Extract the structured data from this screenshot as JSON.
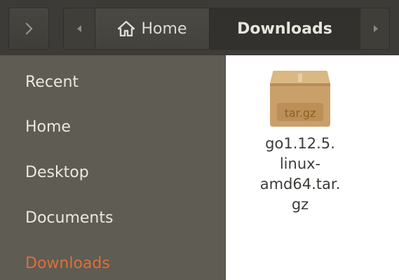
{
  "toolbar": {
    "expand_icon": "chevron-right-icon",
    "path": {
      "back_icon": "triangle-left-icon",
      "home_icon": "home-icon",
      "home_label": "Home",
      "current_label": "Downloads",
      "forward_icon": "triangle-right-icon"
    }
  },
  "sidebar": {
    "items": [
      {
        "label": "Recent",
        "active": false
      },
      {
        "label": "Home",
        "active": false
      },
      {
        "label": "Desktop",
        "active": false
      },
      {
        "label": "Documents",
        "active": false
      },
      {
        "label": "Downloads",
        "active": true
      }
    ],
    "active_color": "#e16e37"
  },
  "content": {
    "files": [
      {
        "icon": "archive-icon",
        "badge": "tar.gz",
        "name_lines": [
          "go1.12.5.",
          "linux-",
          "amd64.tar.",
          "gz"
        ]
      }
    ]
  },
  "colors": {
    "toolbar_bg": "#3c3b37",
    "sidebar_bg": "#5e5c53",
    "content_bg": "#ffffff"
  }
}
